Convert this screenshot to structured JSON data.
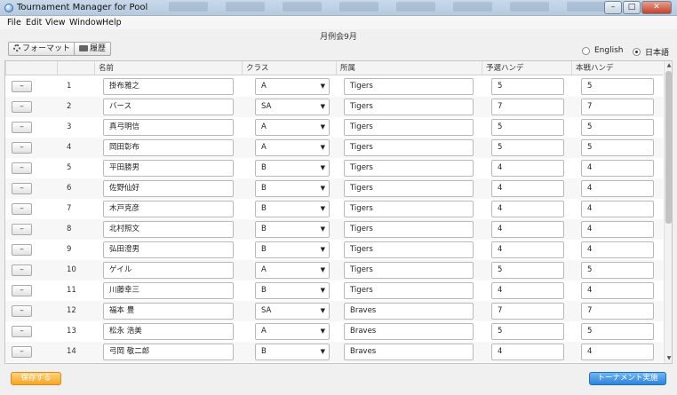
{
  "window": {
    "title": "Tournament Manager for Pool",
    "controls": [
      "–",
      "□",
      "✕"
    ]
  },
  "menu": [
    "File",
    "Edit",
    "View",
    "Window",
    "Help"
  ],
  "subtitle": "月例会9月",
  "toolbar": {
    "format_label": "フォーマット",
    "history_label": "履歴"
  },
  "language": {
    "options": [
      "English",
      "日本語"
    ],
    "selected": "日本語"
  },
  "table": {
    "headers": [
      "名前",
      "クラス",
      "所属",
      "予選ハンデ",
      "本戦ハンデ"
    ],
    "delete_label": "–",
    "rows": [
      {
        "no": "1",
        "name": "掛布雅之",
        "class": "A",
        "team": "Tigers",
        "prelim": "5",
        "main": "5"
      },
      {
        "no": "2",
        "name": "バース",
        "class": "SA",
        "team": "Tigers",
        "prelim": "7",
        "main": "7"
      },
      {
        "no": "3",
        "name": "真弓明信",
        "class": "A",
        "team": "Tigers",
        "prelim": "5",
        "main": "5"
      },
      {
        "no": "4",
        "name": "岡田彰布",
        "class": "A",
        "team": "Tigers",
        "prelim": "5",
        "main": "5"
      },
      {
        "no": "5",
        "name": "平田勝男",
        "class": "B",
        "team": "Tigers",
        "prelim": "4",
        "main": "4"
      },
      {
        "no": "6",
        "name": "佐野仙好",
        "class": "B",
        "team": "Tigers",
        "prelim": "4",
        "main": "4"
      },
      {
        "no": "7",
        "name": "木戸克彦",
        "class": "B",
        "team": "Tigers",
        "prelim": "4",
        "main": "4"
      },
      {
        "no": "8",
        "name": "北村照文",
        "class": "B",
        "team": "Tigers",
        "prelim": "4",
        "main": "4"
      },
      {
        "no": "9",
        "name": "弘田澄男",
        "class": "B",
        "team": "Tigers",
        "prelim": "4",
        "main": "4"
      },
      {
        "no": "10",
        "name": "ゲイル",
        "class": "A",
        "team": "Tigers",
        "prelim": "5",
        "main": "5"
      },
      {
        "no": "11",
        "name": "川藤幸三",
        "class": "B",
        "team": "Tigers",
        "prelim": "4",
        "main": "4"
      },
      {
        "no": "12",
        "name": "福本 豊",
        "class": "SA",
        "team": "Braves",
        "prelim": "7",
        "main": "7"
      },
      {
        "no": "13",
        "name": "松永 浩美",
        "class": "A",
        "team": "Braves",
        "prelim": "5",
        "main": "5"
      },
      {
        "no": "14",
        "name": "弓岡 敬二郎",
        "class": "B",
        "team": "Braves",
        "prelim": "4",
        "main": "4"
      }
    ]
  },
  "footer": {
    "save_label": "保存する",
    "run_label": "トーナメント実施"
  }
}
